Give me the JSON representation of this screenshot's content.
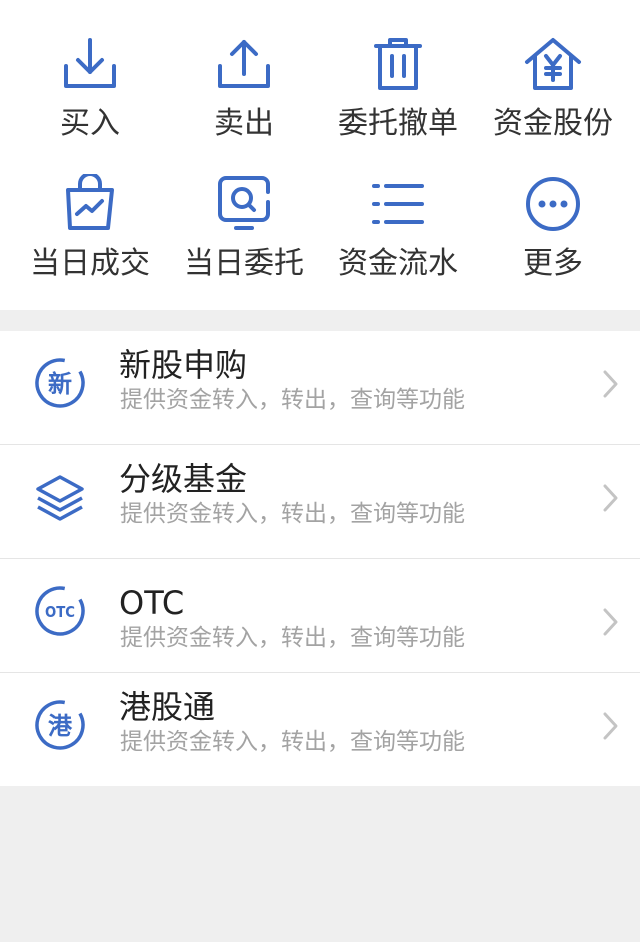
{
  "colors": {
    "icon_blue": "#3c6bc5",
    "text_dark": "#333333",
    "text_gray": "#a3a3a3",
    "chevron_gray": "#c4c4c4",
    "background": "#efefef"
  },
  "quick_actions": [
    {
      "label": "买入",
      "icon": "download-tray-icon"
    },
    {
      "label": "卖出",
      "icon": "upload-tray-icon"
    },
    {
      "label": "委托撤单",
      "icon": "trash-icon"
    },
    {
      "label": "资金股份",
      "icon": "yuan-house-icon"
    },
    {
      "label": "当日成交",
      "icon": "shopping-bag-chart-icon"
    },
    {
      "label": "当日委托",
      "icon": "search-frame-icon"
    },
    {
      "label": "资金流水",
      "icon": "list-icon"
    },
    {
      "label": "更多",
      "icon": "more-dots-icon"
    }
  ],
  "services": [
    {
      "title": "新股申购",
      "subtitle": "提供资金转入，转出，查询等功能",
      "icon": "new-stock-icon",
      "badge": "新"
    },
    {
      "title": "分级基金",
      "subtitle": "提供资金转入，转出，查询等功能",
      "icon": "layers-icon"
    },
    {
      "title": "OTC",
      "subtitle": "提供资金转入，转出，查询等功能",
      "icon": "otc-icon",
      "badge": "OTC"
    },
    {
      "title": "港股通",
      "subtitle": "提供资金转入，转出，查询等功能",
      "icon": "hk-connect-icon",
      "badge": "港"
    }
  ]
}
